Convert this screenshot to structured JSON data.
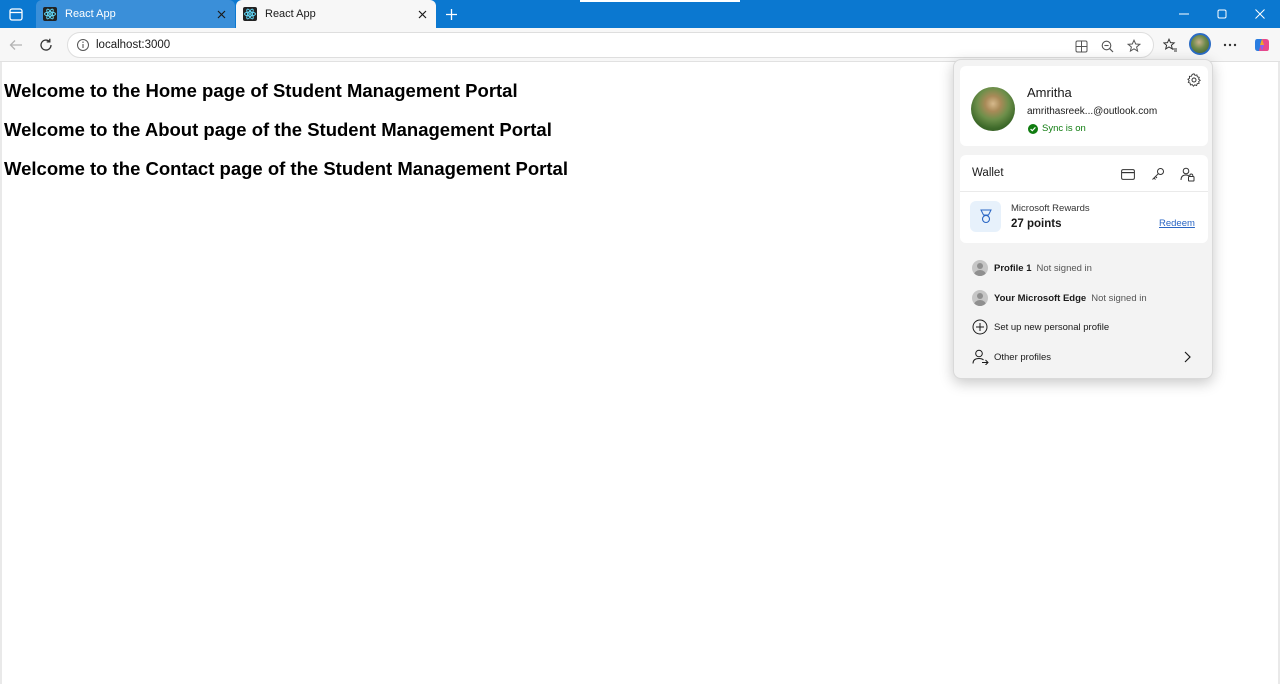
{
  "browser": {
    "tabs": [
      {
        "label": "React App",
        "favicon": "react-icon",
        "active": false
      },
      {
        "label": "React App",
        "favicon": "react-icon",
        "active": true
      }
    ],
    "address": {
      "url": "localhost:3000"
    },
    "icons": {
      "back": "arrow-left-icon",
      "refresh": "refresh-icon",
      "info": "info-icon",
      "app_available": "app-grid-icon",
      "zoom": "zoom-out-icon",
      "favorite": "star-icon",
      "favorites": "favorites-icon",
      "more": "more-icon",
      "copilot": "copilot-icon"
    },
    "colors": {
      "titlebar": "#0b78d0",
      "accent": "#2a66c4",
      "sync": "#107c10"
    }
  },
  "page": {
    "headings": [
      "Welcome to the Home page of Student Management Portal",
      "Welcome to the About page of the Student Management Portal",
      "Welcome to the Contact page of the Student Management Portal"
    ]
  },
  "profile_panel": {
    "name": "Amritha",
    "email": "amrithasreek...@outlook.com",
    "sync": "Sync is on",
    "wallet": {
      "title": "Wallet",
      "rewards_label": "Microsoft Rewards",
      "rewards_points": "27 points",
      "redeem": "Redeem"
    },
    "profiles": [
      {
        "name": "Profile 1",
        "status": "Not signed in"
      },
      {
        "name": "Your Microsoft Edge",
        "status": "Not signed in"
      }
    ],
    "add_profile": "Set up new personal profile",
    "other_profiles": "Other profiles"
  }
}
